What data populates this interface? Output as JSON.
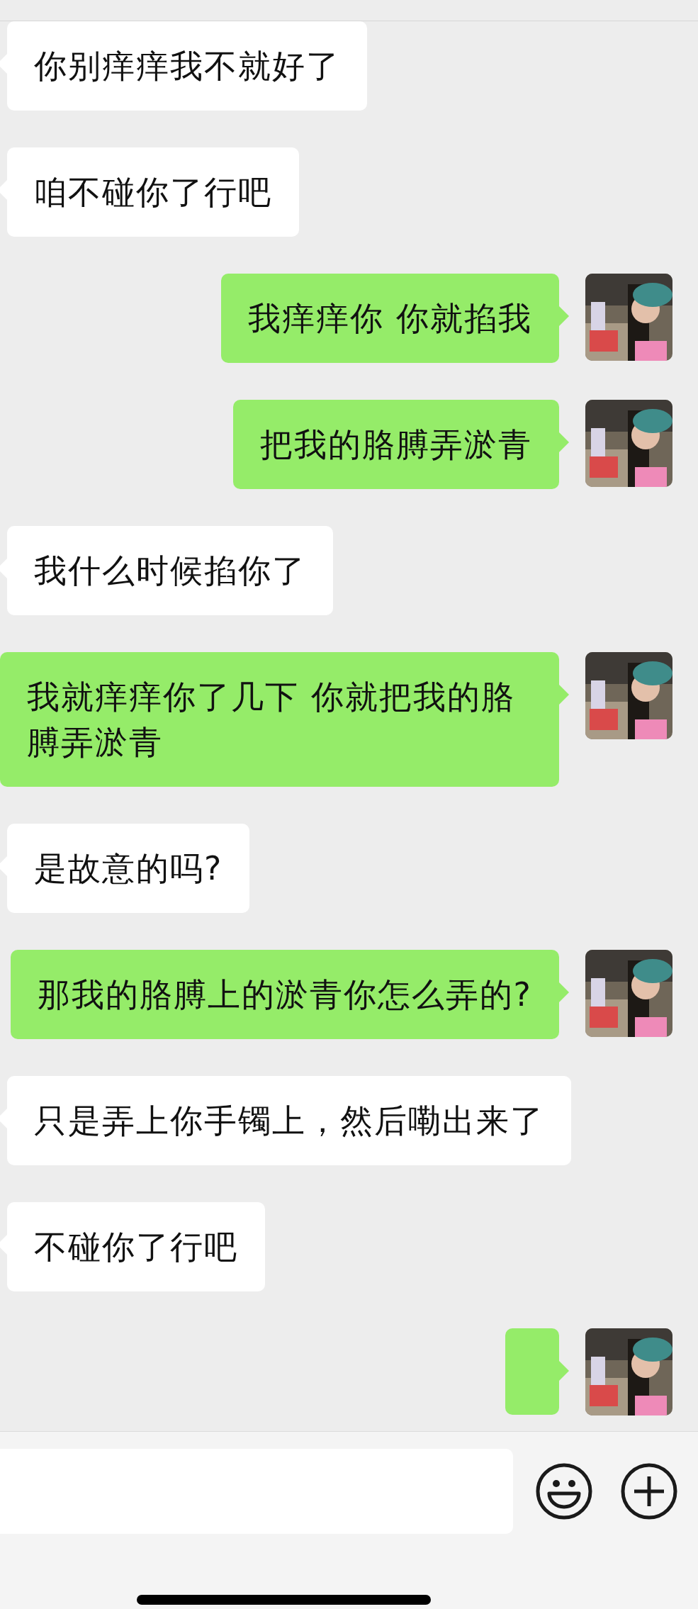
{
  "messages": [
    {
      "kind": "in",
      "text": "你别痒痒我不就好了"
    },
    {
      "kind": "in",
      "text": "咱不碰你了行吧"
    },
    {
      "kind": "out",
      "text": "我痒痒你 你就掐我"
    },
    {
      "kind": "out",
      "text": "把我的胳膊弄淤青"
    },
    {
      "kind": "in",
      "text": "我什么时候掐你了"
    },
    {
      "kind": "out",
      "text": "我就痒痒你了几下 你就把我的胳膊弄淤青"
    },
    {
      "kind": "in",
      "text": "是故意的吗?"
    },
    {
      "kind": "out",
      "text": "那我的胳膊上的淤青你怎么弄的?"
    },
    {
      "kind": "in",
      "text": "只是弄上你手镯上，然后嘞出来了"
    },
    {
      "kind": "in",
      "text": "不碰你了行吧"
    },
    {
      "kind": "out"
    }
  ]
}
